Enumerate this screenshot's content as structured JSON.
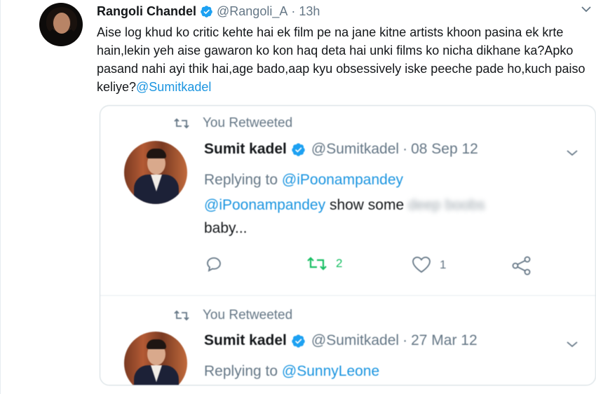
{
  "tweet": {
    "author_name": "Rangoli Chandel",
    "handle": "@Rangoli_A",
    "separator": "·",
    "time": "13h",
    "text": "Aise log khud ko critic kehte hai ek film pe na jane kitne artists khoon pasina ek krte hain,lekin yeh aise gawaron ko kon haq deta hai unki films ko nicha dikhane ka?Apko pasand nahi ayi thik hai,age bado,aap kyu obsessively iske peeche pade ho,kuch paiso keliye?",
    "mention": "@Sumitkadel",
    "verified_icon": "verified-badge-icon",
    "menu_icon": "chevron-down-icon"
  },
  "quoted": [
    {
      "retweet_label": "You Retweeted",
      "author_name": "Sumit kadel",
      "handle": "@Sumitkadel",
      "separator": "·",
      "date": "08 Sep 12",
      "reply_prefix": "Replying to",
      "reply_to": "@iPoonampandey",
      "text_mention": "@iPoonampandey",
      "text_visible": "show some",
      "text_blurred": "deep boobs",
      "text_line2": "baby...",
      "actions": {
        "reply_icon": "reply-icon",
        "retweet_icon": "retweet-icon",
        "retweet_count": "2",
        "like_icon": "heart-icon",
        "like_count": "1",
        "share_icon": "share-icon"
      }
    },
    {
      "retweet_label": "You Retweeted",
      "author_name": "Sumit kadel",
      "handle": "@Sumitkadel",
      "separator": "·",
      "date": "27 Mar 12",
      "reply_prefix": "Replying to",
      "reply_to": "@SunnyLeone"
    }
  ],
  "colors": {
    "link": "#1b95e0",
    "muted": "#657786",
    "retweet_green": "#17bf63",
    "verified_blue": "#1da1f2",
    "text": "#14171a"
  }
}
